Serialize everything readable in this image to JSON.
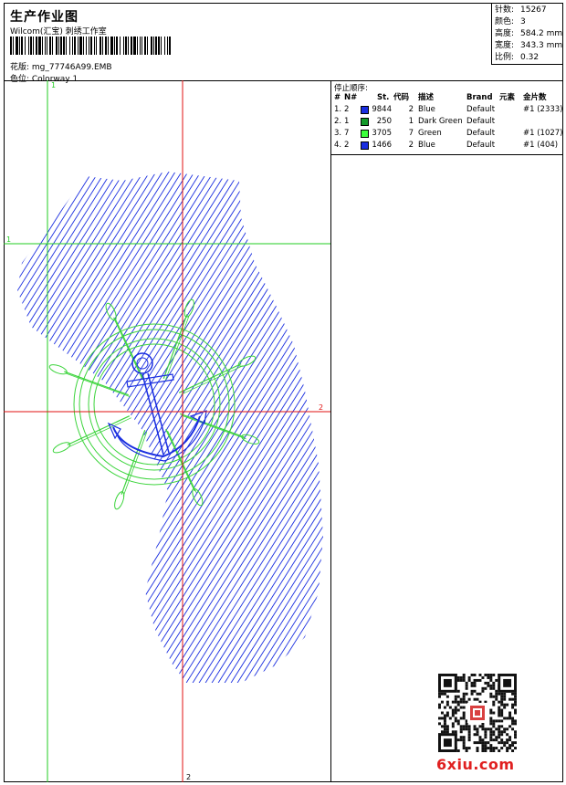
{
  "header": {
    "title": "生产作业图",
    "studio": "Wilcom(汇宝) 刺绣工作室",
    "design": "花版: mg_77746A99.EMB",
    "colorway": "色位: Colorway 1"
  },
  "stats": [
    {
      "label": "针数:",
      "value": "15267"
    },
    {
      "label": "颜色:",
      "value": "3"
    },
    {
      "label": "高度:",
      "value": "584.2 mm"
    },
    {
      "label": "宽度:",
      "value": "343.3 mm"
    },
    {
      "label": "比例:",
      "value": "0.32"
    }
  ],
  "sequence": {
    "title": "停止顺序:",
    "headers": [
      "#",
      "N#",
      "St.",
      "代码",
      "描述",
      "Brand",
      "元素",
      "金片数"
    ],
    "rows": [
      {
        "num": "1.",
        "n": "2",
        "color": "#1a2ee0",
        "st": "9844",
        "code": "2",
        "desc": "Blue",
        "brand": "Default",
        "elem": "",
        "seq": "#1 (2333)"
      },
      {
        "num": "2.",
        "n": "1",
        "color": "#139a2a",
        "st": "250",
        "code": "1",
        "desc": "Dark Green",
        "brand": "Default",
        "elem": "",
        "seq": ""
      },
      {
        "num": "3.",
        "n": "7",
        "color": "#3cff3c",
        "st": "3705",
        "code": "7",
        "desc": "Green",
        "brand": "Default",
        "elem": "",
        "seq": "#1 (1027)"
      },
      {
        "num": "4.",
        "n": "2",
        "color": "#1a2ee0",
        "st": "1466",
        "code": "2",
        "desc": "Blue",
        "brand": "Default",
        "elem": "",
        "seq": "#1 (404)"
      }
    ]
  },
  "guides": {
    "v1": "1",
    "h1": "1",
    "h2": "2",
    "v2": "2"
  },
  "watermark": "6xiu.com",
  "colors": {
    "blue": "#1a2ee0",
    "green": "#3cd43c",
    "red": "#e01010",
    "guide_green": "#22cc22"
  }
}
